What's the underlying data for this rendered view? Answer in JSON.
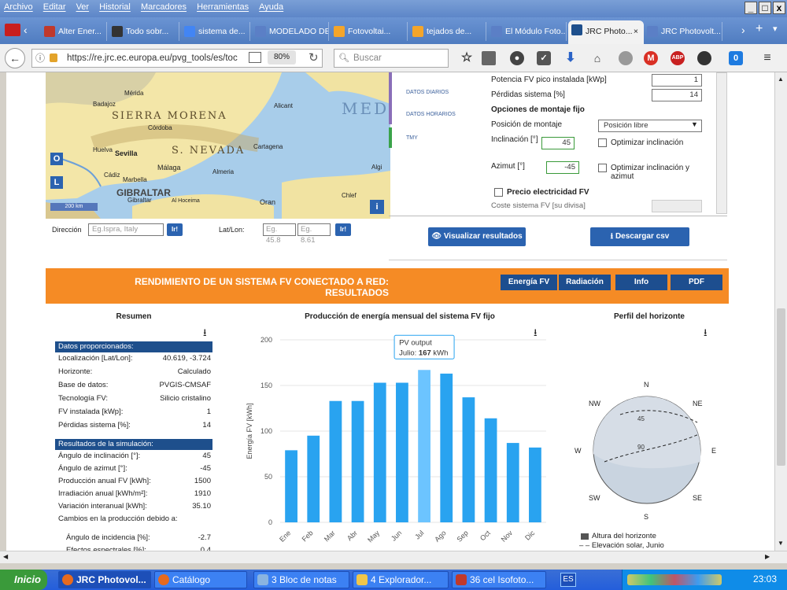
{
  "menu": [
    "Archivo",
    "Editar",
    "Ver",
    "Historial",
    "Marcadores",
    "Herramientas",
    "Ayuda"
  ],
  "window_controls": [
    "_",
    "□",
    "x"
  ],
  "tabs": [
    {
      "label": "Alter Ener...",
      "color": "#c0392b"
    },
    {
      "label": "Todo sobr...",
      "color": "#333"
    },
    {
      "label": "sistema de...",
      "color": "#4285f4"
    },
    {
      "label": "MODELADO DE...",
      "color": "#5b7fc6"
    },
    {
      "label": "Fotovoltai...",
      "color": "#f4a52a"
    },
    {
      "label": "tejados de...",
      "color": "#f4a52a"
    },
    {
      "label": "El Módulo Foto...",
      "color": "#5b7fc6"
    },
    {
      "label": "JRC Photo...",
      "color": "#fff",
      "active": true
    },
    {
      "label": "JRC Photovolt...",
      "color": "#5b7fc6"
    }
  ],
  "nav": {
    "url": "https://re.jrc.ec.europa.eu/pvg_tools/es/toc",
    "zoom": "80%",
    "search_placeholder": "Buscar"
  },
  "map": {
    "labels": [
      "SIERRA MORENA",
      "S. NEVADA",
      "GIBRALTAR",
      "Sevilla",
      "Málaga",
      "Almeria",
      "Cartagena",
      "Córdoba",
      "Mérida",
      "Badajoz",
      "Huelva",
      "Cádiz",
      "Oran",
      "Chlef",
      "Alicant",
      "Algi",
      "Marbella",
      "Al Hoceima",
      "Gibraltar",
      "MED"
    ],
    "scale": "200 km",
    "btn_o": "O",
    "btn_l": "L",
    "btn_i": "i"
  },
  "address": {
    "dir_label": "Dirección",
    "dir_placeholder": "Eg.Ispra, Italy",
    "go": "Ir!",
    "latlon_label": "Lat/Lon:",
    "lat_placeholder": "Eg. 45.8",
    "lon_placeholder": "Eg. 8.61"
  },
  "sidetabs": [
    "DATOS DIARIOS",
    "DATOS HORARIOS",
    "TMY"
  ],
  "form": {
    "pv_power_label": "Potencia FV pico instalada [kWp]",
    "pv_power_value": "1",
    "losses_label": "Pérdidas sistema [%]",
    "losses_value": "14",
    "mount_header": "Opciones de montaje fijo",
    "mount_pos_label": "Posición de montaje",
    "mount_pos_value": "Posición libre",
    "incl_label": "Inclinación [°]",
    "incl_value": "45",
    "opt_incl": "Optimizar inclinación",
    "azim_label": "Azimut [°]",
    "azim_value": "-45",
    "opt_both": "Optimizar inclinación y azimut",
    "price_label": "Precio electricidad FV",
    "cost_label": "Coste sistema FV [su divisa]"
  },
  "buttons": {
    "view": "Visualizar resultados",
    "csv": "Descargar csv"
  },
  "results": {
    "title_line1": "RENDIMIENTO DE UN SISTEMA FV CONECTADO A RED:",
    "title_line2": "RESULTADOS",
    "tabs": [
      "Energía FV",
      "Radiación",
      "Info",
      "PDF"
    ]
  },
  "summary": {
    "title": "Resumen",
    "provided_header": "Datos proporcionados:",
    "provided": [
      [
        "Localización [Lat/Lon]:",
        "40.619, -3.724"
      ],
      [
        "Horizonte:",
        "Calculado"
      ],
      [
        "Base de datos:",
        "PVGIS-CMSAF"
      ],
      [
        "Tecnología FV:",
        "Silicio cristalino"
      ],
      [
        "FV instalada [kWp]:",
        "1"
      ],
      [
        "Pérdidas sistema [%]:",
        "14"
      ]
    ],
    "sim_header": "Resultados de la simulación:",
    "sim": [
      [
        "Ángulo de inclinación [°]:",
        "45"
      ],
      [
        "Ángulo de azimut [°]:",
        "-45"
      ],
      [
        "Producción anual FV [kWh]:",
        "1500"
      ],
      [
        "Irradiación anual [kWh/m²]:",
        "1910"
      ],
      [
        "Variación interanual [kWh]:",
        "35.10"
      ]
    ],
    "changes_label": "Cambios en la producción debido a:",
    "changes": [
      [
        "Ángulo de incidencia [%]:",
        "-2.7"
      ],
      [
        "Efectos espectrales [%]:",
        "0.4"
      ]
    ]
  },
  "chart_data": {
    "type": "bar",
    "title": "Producción de energía mensual del sistema FV fijo",
    "ylabel": "Energía FV [kWh]",
    "categories": [
      "Ene",
      "Feb",
      "Mar",
      "Abr",
      "May",
      "Jun",
      "Jul",
      "Ago",
      "Sep",
      "Oct",
      "Nov",
      "Dic"
    ],
    "values": [
      79,
      95,
      133,
      133,
      153,
      153,
      167,
      163,
      137,
      114,
      87,
      82
    ],
    "ylim": [
      0,
      200
    ],
    "yticks": [
      0,
      50,
      100,
      150,
      200
    ],
    "bar_color": "#29a3f0",
    "highlight_color": "#6cc4ff",
    "tooltip": {
      "series": "PV output",
      "label": "Julio:",
      "value": "167",
      "unit": "kWh"
    }
  },
  "horizon": {
    "title": "Perfil del horizonte",
    "dirs": [
      "N",
      "NE",
      "E",
      "SE",
      "S",
      "SW",
      "W",
      "NW"
    ],
    "rings": [
      "45",
      "90"
    ],
    "legend": [
      "Altura del horizonte",
      "Elevación solar, Junio"
    ]
  },
  "taskbar": {
    "start": "Inicio",
    "items": [
      "JRC Photovol...",
      "Catálogo",
      "3 Bloc de notas",
      "4 Explorador...",
      "36 cel Isofoto..."
    ],
    "lang": "ES",
    "clock": "23:03"
  }
}
